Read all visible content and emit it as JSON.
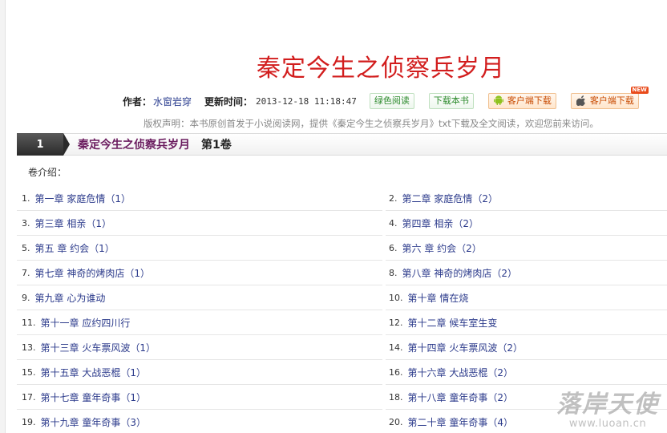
{
  "book": {
    "title": "秦定今生之侦察兵岁月",
    "author_label": "作者：",
    "author": "水窗岩穿",
    "update_label": "更新时间：",
    "update_time": "2013-12-18 11:18:47"
  },
  "buttons": {
    "green_read": "绿色阅读",
    "download_book": "下载本书",
    "android_client": "客户端下载",
    "ios_client": "客户端下载",
    "new_badge": "NEW"
  },
  "copyright": "版权声明：本书原创首发于小说阅读网，提供《秦定今生之侦察兵岁月》txt下载及全文阅读，欢迎您前来访问。",
  "volume": {
    "number": "1",
    "title": "秦定今生之侦察兵岁月",
    "label": "第1卷"
  },
  "intro_label": "卷介绍：",
  "chapters": [
    [
      "1.",
      "第一章 家庭危情（1）",
      "2.",
      "第二章 家庭危情（2）"
    ],
    [
      "3.",
      "第三章 相亲（1）",
      "4.",
      "第四章 相亲（2）"
    ],
    [
      "5.",
      "第五 章 约会（1）",
      "6.",
      "第六 章 约会（2）"
    ],
    [
      "7.",
      "第七章 神奇的烤肉店（1）",
      "8.",
      "第八章 神奇的烤肉店（2）"
    ],
    [
      "9.",
      "第九章 心为谁动",
      "10.",
      "第十章 情在烧"
    ],
    [
      "11.",
      "第十一章 应约四川行",
      "12.",
      "第十二章 候车室生变"
    ],
    [
      "13.",
      "第十三章 火车票风波（1）",
      "14.",
      "第十四章 火车票风波（2）"
    ],
    [
      "15.",
      "第十五章 大战恶棍（1）",
      "16.",
      "第十六章 大战恶棍（2）"
    ],
    [
      "17.",
      "第十七章 童年奇事（1）",
      "18.",
      "第十八章 童年奇事（2）"
    ],
    [
      "19.",
      "第十九章 童年奇事（3）",
      "20.",
      "第二十章 童年奇事（4）"
    ]
  ],
  "watermark": {
    "text": "落岸天使",
    "url": "www.luoan.cn"
  },
  "icons": {
    "android": "android-icon",
    "apple": "apple-icon"
  }
}
